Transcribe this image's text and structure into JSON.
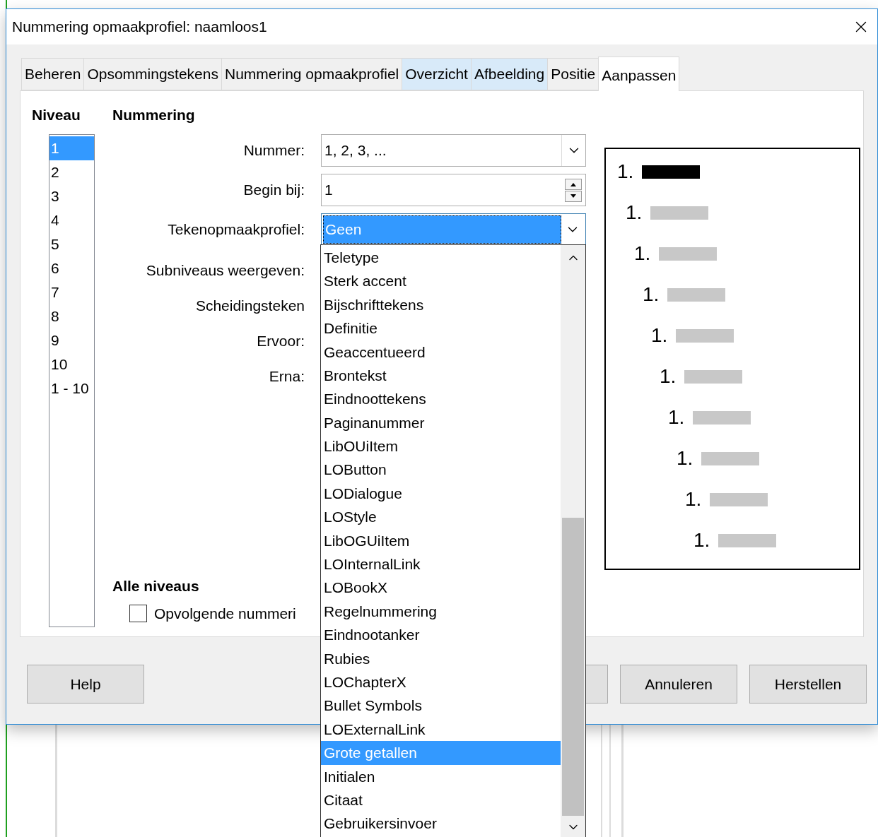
{
  "window": {
    "title": "Nummering opmaakprofiel: naamloos1"
  },
  "tabs": [
    {
      "label": "Beheren",
      "selected": false,
      "highlighted": false
    },
    {
      "label": "Opsommingstekens",
      "selected": false,
      "highlighted": false
    },
    {
      "label": "Nummering opmaakprofiel",
      "selected": false,
      "highlighted": false
    },
    {
      "label": "Overzicht",
      "selected": false,
      "highlighted": true
    },
    {
      "label": "Afbeelding",
      "selected": false,
      "highlighted": true
    },
    {
      "label": "Positie",
      "selected": false,
      "highlighted": false
    },
    {
      "label": "Aanpassen",
      "selected": true,
      "highlighted": false
    }
  ],
  "niveau": {
    "heading": "Niveau",
    "items": [
      {
        "label": "1",
        "selected": true
      },
      {
        "label": "2",
        "selected": false
      },
      {
        "label": "3",
        "selected": false
      },
      {
        "label": "4",
        "selected": false
      },
      {
        "label": "5",
        "selected": false
      },
      {
        "label": "6",
        "selected": false
      },
      {
        "label": "7",
        "selected": false
      },
      {
        "label": "8",
        "selected": false
      },
      {
        "label": "9",
        "selected": false
      },
      {
        "label": "10",
        "selected": false
      },
      {
        "label": "1 - 10",
        "selected": false
      }
    ]
  },
  "nummering": {
    "heading": "Nummering",
    "fields": [
      {
        "kind": "dropdown",
        "label": "Nummer:",
        "value": "1, 2, 3, ...",
        "focused": false
      },
      {
        "kind": "spin",
        "label": "Begin bij:",
        "value": "1"
      },
      {
        "kind": "dropdown",
        "label": "Tekenopmaakprofiel:",
        "value": "Geen",
        "focused": true
      },
      {
        "kind": "label",
        "label": "Subniveaus weergeven:"
      },
      {
        "kind": "label",
        "label": "Scheidingsteken"
      },
      {
        "kind": "label",
        "label": "Ervoor:"
      },
      {
        "kind": "label",
        "label": "Erna:"
      }
    ]
  },
  "alle_niveaus": {
    "heading": "Alle niveaus",
    "checkbox": {
      "label": "Opvolgende nummeri",
      "checked": false
    }
  },
  "preview": [
    {
      "label": "1.",
      "selected": true
    },
    {
      "label": "1.",
      "selected": false
    },
    {
      "label": "1.",
      "selected": false
    },
    {
      "label": "1.",
      "selected": false
    },
    {
      "label": "1.",
      "selected": false
    },
    {
      "label": "1.",
      "selected": false
    },
    {
      "label": "1.",
      "selected": false
    },
    {
      "label": "1.",
      "selected": false
    },
    {
      "label": "1.",
      "selected": false
    },
    {
      "label": "1.",
      "selected": false
    }
  ],
  "buttons": [
    {
      "kind": "button",
      "label": "Help"
    },
    {
      "kind": "covered"
    },
    {
      "kind": "button",
      "label": "Annuleren"
    },
    {
      "kind": "button",
      "label": "Herstellen"
    }
  ],
  "dropdown_list": [
    {
      "label": "Teletype",
      "selected": false
    },
    {
      "label": "Sterk accent",
      "selected": false
    },
    {
      "label": "Bijschrifttekens",
      "selected": false
    },
    {
      "label": "Definitie",
      "selected": false
    },
    {
      "label": "Geaccentueerd",
      "selected": false
    },
    {
      "label": "Brontekst",
      "selected": false
    },
    {
      "label": "Eindnoottekens",
      "selected": false
    },
    {
      "label": "Paginanummer",
      "selected": false
    },
    {
      "label": "LibOUiItem",
      "selected": false
    },
    {
      "label": "LOButton",
      "selected": false
    },
    {
      "label": "LODialogue",
      "selected": false
    },
    {
      "label": "LOStyle",
      "selected": false
    },
    {
      "label": "LibOGUiItem",
      "selected": false
    },
    {
      "label": "LOInternalLink",
      "selected": false
    },
    {
      "label": "LOBookX",
      "selected": false
    },
    {
      "label": "Regelnummering",
      "selected": false
    },
    {
      "label": "Eindnootanker",
      "selected": false
    },
    {
      "label": "Rubies",
      "selected": false
    },
    {
      "label": "LOChapterX",
      "selected": false
    },
    {
      "label": "Bullet Symbols",
      "selected": false
    },
    {
      "label": "LOExternalLink",
      "selected": false
    },
    {
      "label": "Grote getallen",
      "selected": true
    },
    {
      "label": "Initialen",
      "selected": false
    },
    {
      "label": "Citaat",
      "selected": false
    },
    {
      "label": "Gebruikersinvoer",
      "selected": false
    }
  ]
}
